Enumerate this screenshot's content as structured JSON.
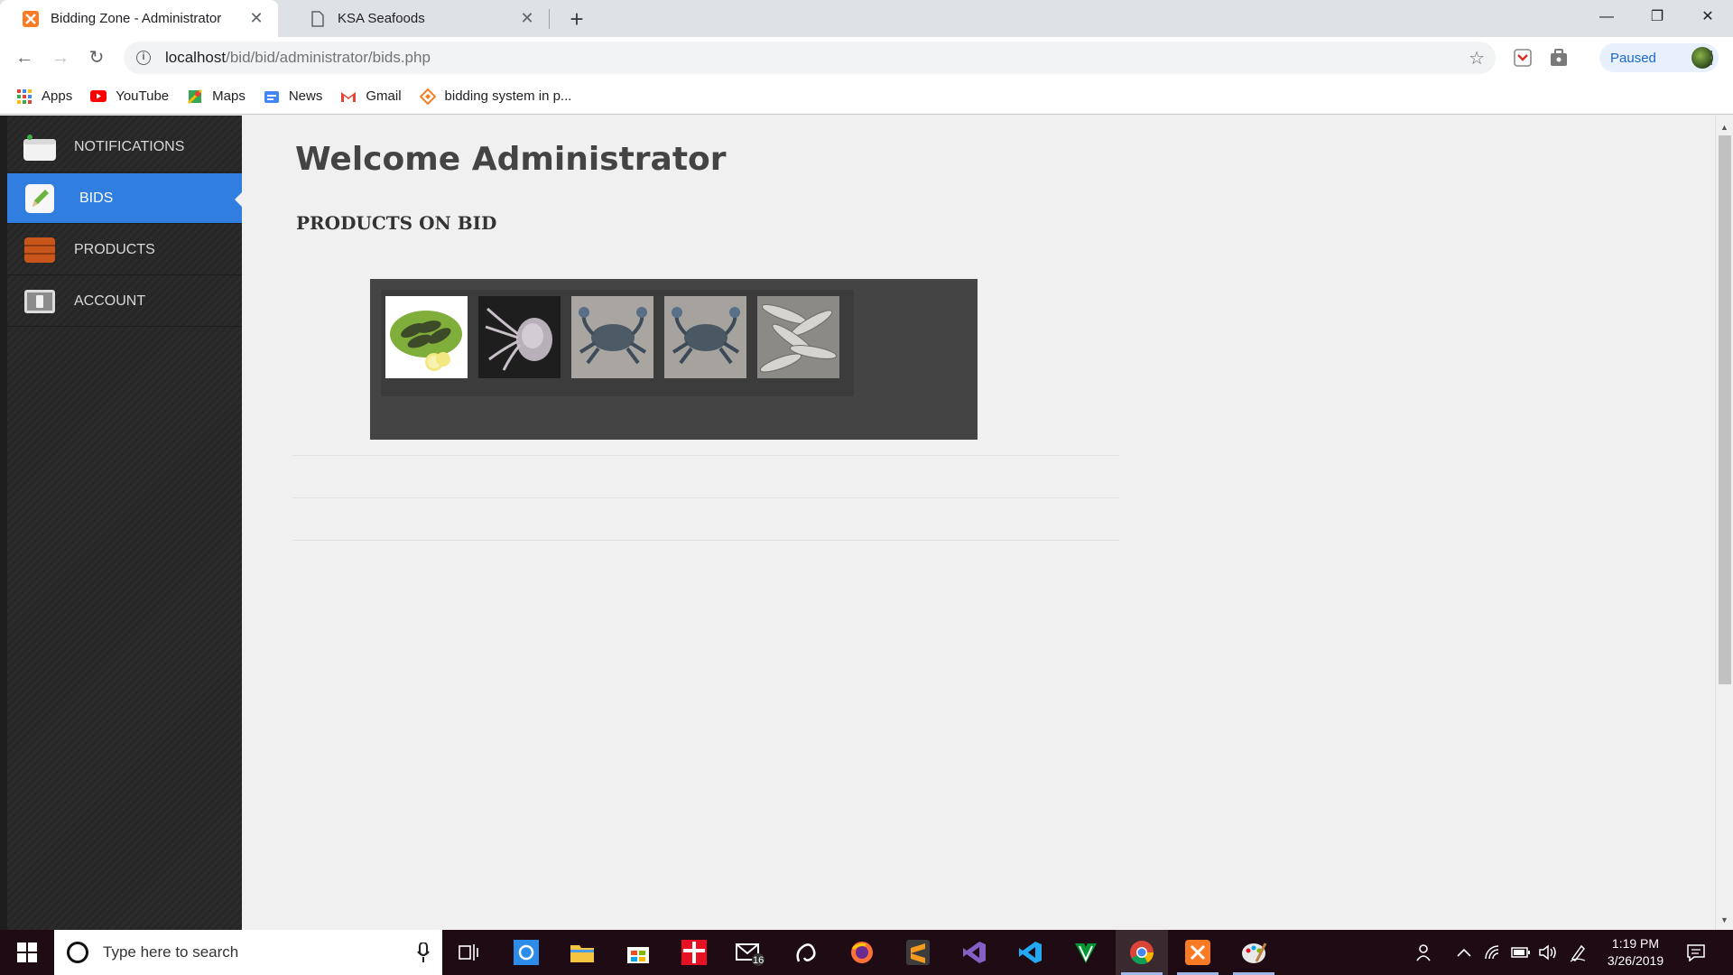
{
  "browser": {
    "tabs": [
      {
        "title": "Bidding Zone - Administrator",
        "active": true
      },
      {
        "title": "KSA Seafoods",
        "active": false
      }
    ],
    "url_host": "localhost",
    "url_path": "/bid/bid/administrator/bids.php",
    "profile_label": "Paused",
    "bookmarks": [
      {
        "label": "Apps",
        "icon": "apps-grid-icon"
      },
      {
        "label": "YouTube",
        "icon": "youtube-icon"
      },
      {
        "label": "Maps",
        "icon": "maps-icon"
      },
      {
        "label": "News",
        "icon": "news-icon"
      },
      {
        "label": "Gmail",
        "icon": "gmail-icon"
      },
      {
        "label": "bidding system in p...",
        "icon": "bookmark-site-icon"
      }
    ]
  },
  "sidebar": {
    "items": [
      {
        "label": "NOTIFICATIONS",
        "icon": "notifications-icon",
        "active": false
      },
      {
        "label": "BIDS",
        "icon": "bids-pencil-icon",
        "active": true
      },
      {
        "label": "PRODUCTS",
        "icon": "products-box-icon",
        "active": false
      },
      {
        "label": "ACCOUNT",
        "icon": "account-icon",
        "active": false
      }
    ]
  },
  "main": {
    "welcome": "Welcome Administrator",
    "section_title": "PRODUCTS ON BID",
    "products": [
      {
        "icon": "shrimp-image"
      },
      {
        "icon": "squid-image"
      },
      {
        "icon": "crab-image"
      },
      {
        "icon": "crab-image"
      },
      {
        "icon": "fish-image"
      }
    ]
  },
  "taskbar": {
    "search_placeholder": "Type here to search",
    "mail_badge": "16",
    "time": "1:19 PM",
    "date": "3/26/2019"
  },
  "colors": {
    "accent": "#2f7ee0",
    "sidebar_bg": "#262626",
    "gallery_bg": "#444444",
    "taskbar_bg": "#1f0b14"
  }
}
